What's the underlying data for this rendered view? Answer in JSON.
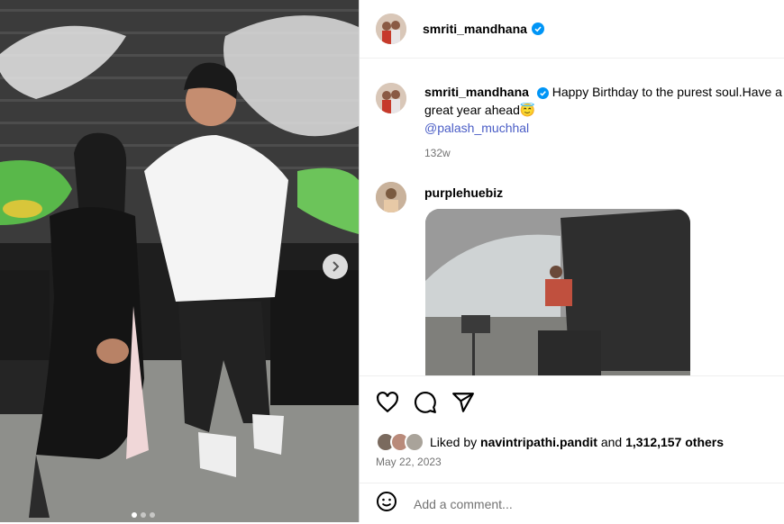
{
  "post": {
    "username": "smriti_mandhana",
    "verified": true,
    "photo_alt": "",
    "carousel": {
      "count": 3,
      "active_index": 0,
      "next_icon": "chevron-right-icon"
    }
  },
  "caption": {
    "username": "smriti_mandhana",
    "text": "Happy Birthday to the purest soul.Have a great year ahead",
    "emoji": "😇",
    "mention": "@palash_muchhal",
    "age": "132w"
  },
  "comment": {
    "username": "purplehuebiz"
  },
  "actions": {
    "like_icon": "heart-icon",
    "comment_icon": "comment-icon",
    "share_icon": "share-icon"
  },
  "likes": {
    "prefix": "Liked by ",
    "user": "navintripathi.pandit",
    "middle": " and ",
    "count": "1,312,157 others"
  },
  "date": "May 22, 2023",
  "add_comment": {
    "placeholder": "Add a comment...",
    "emoji_icon": "smiley-icon"
  },
  "colors": {
    "verified": "#0095f6",
    "mention": "#4a5dc6",
    "secondary_text": "#737373",
    "border": "#dbdbdb"
  }
}
